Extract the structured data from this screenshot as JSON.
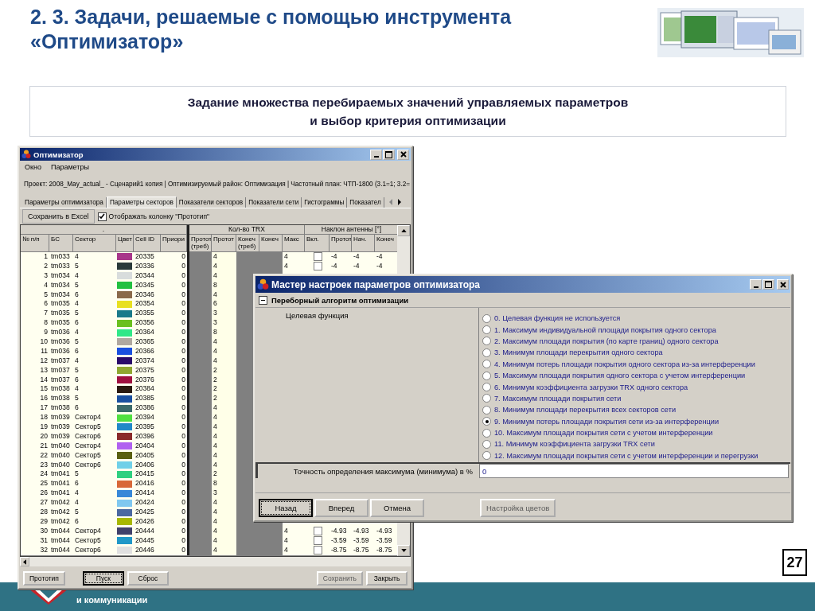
{
  "slide": {
    "title": "2. 3. Задачи, решаемые с помощью инструмента «Оптимизатор»",
    "heading_lines": [
      "Задание множества перебираемых значений управляемых параметров",
      "и выбор критерия оптимизации"
    ],
    "footer_text": "и коммуникации",
    "page_number": "27"
  },
  "main_window": {
    "title": "Оптимизатор",
    "menu": [
      "Окно",
      "Параметры"
    ],
    "project_line": "Проект: 2008_May_actual_ - Сценарий1 копия  |  Оптимизируемый район: Оптимизация  |  Частотный план: ЧТП-1800 (3.1=1; 3.2=",
    "tabs": [
      {
        "label": "Параметры оптимизатора",
        "selected": false
      },
      {
        "label": "Параметры секторов",
        "selected": true
      },
      {
        "label": "Показатели секторов",
        "selected": false
      },
      {
        "label": "Показатели сети",
        "selected": false
      },
      {
        "label": "Гистограммы",
        "selected": false
      },
      {
        "label": "Показател",
        "selected": false
      }
    ],
    "toolbar": {
      "save_button": "Сохранить в Excel",
      "show_column": {
        "label": "Отображать колонку \"Прототип\"",
        "checked": true
      }
    },
    "table": {
      "groups": [
        ".",
        "Кол-во TRX",
        "Наклон антенны [°]"
      ],
      "columns": [
        "№ п/п",
        "БС",
        "Сектор",
        "Цвет",
        "Cell ID",
        "Приори",
        "Протот (треб)",
        "Протот",
        "Конеч (треб)",
        "Конеч",
        "Макс",
        "Вкл.",
        "Протот",
        "Нач.",
        "Конеч"
      ],
      "rows": [
        {
          "n": "1",
          "bs": "tm033",
          "sector": "4",
          "color": "#a8368a",
          "cell_id": "20335",
          "priority": "0",
          "proto": "4",
          "max": "4",
          "enabled": false,
          "tilt": [
            "-4",
            "-4",
            "-4"
          ]
        },
        {
          "n": "2",
          "bs": "tm033",
          "sector": "5",
          "color": "#2a3a3a",
          "cell_id": "20336",
          "priority": "0",
          "proto": "4",
          "max": "4",
          "enabled": false,
          "tilt": [
            "-4",
            "-4",
            "-4"
          ]
        },
        {
          "n": "3",
          "bs": "tm034",
          "sector": "4",
          "color": "#d8dcdc",
          "cell_id": "20344",
          "priority": "0",
          "proto": "4"
        },
        {
          "n": "4",
          "bs": "tm034",
          "sector": "5",
          "color": "#22c040",
          "cell_id": "20345",
          "priority": "0",
          "proto": "8"
        },
        {
          "n": "5",
          "bs": "tm034",
          "sector": "6",
          "color": "#8a6a4a",
          "cell_id": "20346",
          "priority": "0",
          "proto": "4"
        },
        {
          "n": "6",
          "bs": "tm035",
          "sector": "4",
          "color": "#e8e020",
          "cell_id": "20354",
          "priority": "0",
          "proto": "6"
        },
        {
          "n": "7",
          "bs": "tm035",
          "sector": "5",
          "color": "#1a7a8a",
          "cell_id": "20355",
          "priority": "0",
          "proto": "3"
        },
        {
          "n": "8",
          "bs": "tm035",
          "sector": "6",
          "color": "#6ac020",
          "cell_id": "20356",
          "priority": "0",
          "proto": "3"
        },
        {
          "n": "9",
          "bs": "tm036",
          "sector": "4",
          "color": "#30e888",
          "cell_id": "20364",
          "priority": "0",
          "proto": "8"
        },
        {
          "n": "10",
          "bs": "tm036",
          "sector": "5",
          "color": "#b0a8a0",
          "cell_id": "20365",
          "priority": "0",
          "proto": "4"
        },
        {
          "n": "11",
          "bs": "tm036",
          "sector": "6",
          "color": "#1a50e0",
          "cell_id": "20366",
          "priority": "0",
          "proto": "4"
        },
        {
          "n": "12",
          "bs": "tm037",
          "sector": "4",
          "color": "#2a0a6a",
          "cell_id": "20374",
          "priority": "0",
          "proto": "4"
        },
        {
          "n": "13",
          "bs": "tm037",
          "sector": "5",
          "color": "#90a830",
          "cell_id": "20375",
          "priority": "0",
          "proto": "2"
        },
        {
          "n": "14",
          "bs": "tm037",
          "sector": "6",
          "color": "#a01040",
          "cell_id": "20376",
          "priority": "0",
          "proto": "2"
        },
        {
          "n": "15",
          "bs": "tm038",
          "sector": "4",
          "color": "#2a1a10",
          "cell_id": "20384",
          "priority": "0",
          "proto": "2"
        },
        {
          "n": "16",
          "bs": "tm038",
          "sector": "5",
          "color": "#1a50a0",
          "cell_id": "20385",
          "priority": "0",
          "proto": "2"
        },
        {
          "n": "17",
          "bs": "tm038",
          "sector": "6",
          "color": "#3a6a6a",
          "cell_id": "20386",
          "priority": "0",
          "proto": "4"
        },
        {
          "n": "18",
          "bs": "tm039",
          "sector": "Сектор4",
          "color": "#50e040",
          "cell_id": "20394",
          "priority": "0",
          "proto": "4"
        },
        {
          "n": "19",
          "bs": "tm039",
          "sector": "Сектор5",
          "color": "#2088c8",
          "cell_id": "20395",
          "priority": "0",
          "proto": "4"
        },
        {
          "n": "20",
          "bs": "tm039",
          "sector": "Сектор6",
          "color": "#8a2a2a",
          "cell_id": "20396",
          "priority": "0",
          "proto": "4"
        },
        {
          "n": "21",
          "bs": "tm040",
          "sector": "Сектор4",
          "color": "#b060f0",
          "cell_id": "20404",
          "priority": "0",
          "proto": "4"
        },
        {
          "n": "22",
          "bs": "tm040",
          "sector": "Сектор5",
          "color": "#5a6010",
          "cell_id": "20405",
          "priority": "0",
          "proto": "4"
        },
        {
          "n": "23",
          "bs": "tm040",
          "sector": "Сектор6",
          "color": "#70d0e8",
          "cell_id": "20406",
          "priority": "0",
          "proto": "4"
        },
        {
          "n": "24",
          "bs": "tm041",
          "sector": "5",
          "color": "#30d080",
          "cell_id": "20415",
          "priority": "0",
          "proto": "2"
        },
        {
          "n": "25",
          "bs": "tm041",
          "sector": "6",
          "color": "#d86838",
          "cell_id": "20416",
          "priority": "0",
          "proto": "8"
        },
        {
          "n": "26",
          "bs": "tm041",
          "sector": "4",
          "color": "#3888d8",
          "cell_id": "20414",
          "priority": "0",
          "proto": "3"
        },
        {
          "n": "27",
          "bs": "tm042",
          "sector": "4",
          "color": "#80c8f0",
          "cell_id": "20424",
          "priority": "0",
          "proto": "4"
        },
        {
          "n": "28",
          "bs": "tm042",
          "sector": "5",
          "color": "#4a68a0",
          "cell_id": "20425",
          "priority": "0",
          "proto": "4"
        },
        {
          "n": "29",
          "bs": "tm042",
          "sector": "6",
          "color": "#a8b800",
          "cell_id": "20426",
          "priority": "0",
          "proto": "4"
        },
        {
          "n": "30",
          "bs": "tm044",
          "sector": "Сектор4",
          "color": "#40406a",
          "cell_id": "20444",
          "priority": "0",
          "proto": "4",
          "max": "4",
          "enabled": false,
          "tilt": [
            "-4.93",
            "-4.93",
            "-4.93"
          ]
        },
        {
          "n": "31",
          "bs": "tm044",
          "sector": "Сектор5",
          "color": "#2098c8",
          "cell_id": "20445",
          "priority": "0",
          "proto": "4",
          "max": "4",
          "enabled": false,
          "tilt": [
            "-3.59",
            "-3.59",
            "-3.59"
          ]
        },
        {
          "n": "32",
          "bs": "tm044",
          "sector": "Сектор6",
          "color": "#e0e0e0",
          "cell_id": "20446",
          "priority": "0",
          "proto": "4",
          "max": "4",
          "enabled": false,
          "tilt": [
            "-8.75",
            "-8.75",
            "-8.75"
          ]
        }
      ]
    },
    "buttons": [
      {
        "label": "Прототип",
        "disabled": false,
        "focused": false
      },
      {
        "label": "Пуск",
        "disabled": false,
        "focused": true
      },
      {
        "label": "Сброс",
        "disabled": false,
        "focused": false
      },
      {
        "label": "Сохранить",
        "disabled": true,
        "focused": false
      },
      {
        "label": "Закрыть",
        "disabled": false,
        "focused": false
      }
    ]
  },
  "dialog": {
    "title": "Мастер настроек параметров оптимизатора",
    "section": {
      "label": "Переборный алгоритм оптимизации",
      "expanded": true
    },
    "field_label": "Целевая функция",
    "options": [
      {
        "label": "0. Целевая функция не используется",
        "selected": false
      },
      {
        "label": "1. Максимум индивидуальной площади покрытия одного сектора",
        "selected": false
      },
      {
        "label": "2. Максимум площади покрытия (по карте границ) одного сектора",
        "selected": false
      },
      {
        "label": "3. Минимум площади перекрытия одного сектора",
        "selected": false
      },
      {
        "label": "4. Минимум потерь площади покрытия одного сектора из-за интерференции",
        "selected": false
      },
      {
        "label": "5. Максимум площади покрытия одного сектора с учетом интерференции",
        "selected": false
      },
      {
        "label": "6. Минимум коэффициента загрузки TRX одного сектора",
        "selected": false
      },
      {
        "label": "7. Максимум площади покрытия сети",
        "selected": false
      },
      {
        "label": "8. Минимум площади перекрытия всех секторов сети",
        "selected": false
      },
      {
        "label": "9. Минимум потерь площади покрытия сети из-за интерференции",
        "selected": true
      },
      {
        "label": "10. Максимум площади покрытия сети с учетом интерференции",
        "selected": false
      },
      {
        "label": "11. Минимум коэффициента загрузки TRX сети",
        "selected": false
      },
      {
        "label": "12. Максимум площади покрытия сети с учетом интерференции и перегрузки",
        "selected": false
      }
    ],
    "precision": {
      "label": "Точность определения максимума (минимума) в %",
      "value": "0"
    },
    "buttons": [
      {
        "label": "Назад",
        "disabled": false,
        "focused": true
      },
      {
        "label": "Вперед",
        "disabled": false,
        "focused": false
      },
      {
        "label": "Отмена",
        "disabled": false,
        "focused": false
      },
      {
        "label": "Настройка цветов",
        "disabled": true,
        "focused": false
      }
    ]
  }
}
